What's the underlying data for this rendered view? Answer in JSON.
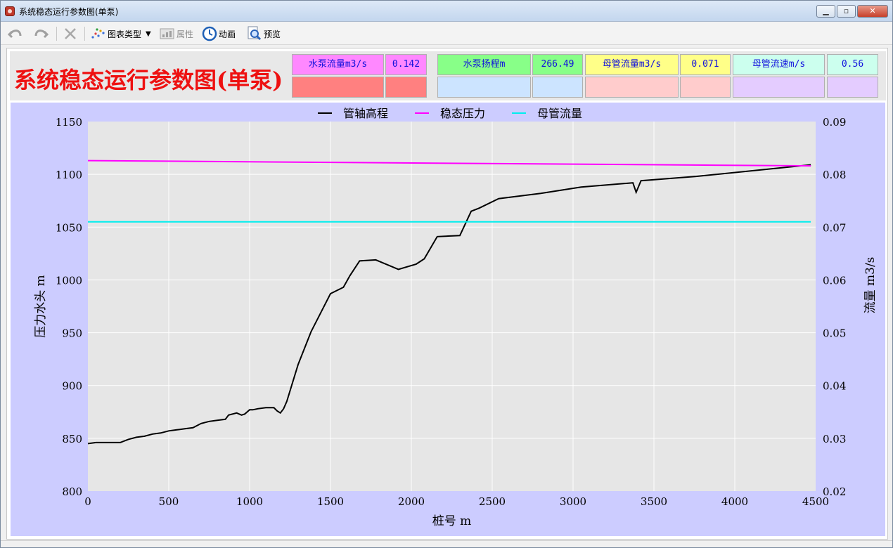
{
  "window": {
    "title": "系统稳态运行参数图(单泵)",
    "min_glyph": "▁",
    "max_glyph": "▫",
    "close_glyph": "✕"
  },
  "toolbar": {
    "undo_icon": "undo-icon",
    "redo_icon": "redo-icon",
    "delete_icon": "delete-icon",
    "chart_type_label": "图表类型",
    "chart_type_arrow": "▼",
    "properties_label": "属性",
    "animation_label": "动画",
    "preview_label": "预览"
  },
  "header": {
    "title": "系统稳态运行参数图(单泵)",
    "params": [
      {
        "label": "水泵流量m3/s",
        "value": "0.142",
        "label_bg": "#ff88ff",
        "value_bg": "#ff88ff",
        "swatch": "#ff8080"
      },
      {
        "label": "水泵扬程m",
        "value": "266.49",
        "label_bg": "#88ff88",
        "value_bg": "#88ff88",
        "swatch": "#cce4ff"
      },
      {
        "label": "母管流量m3/s",
        "value": "0.071",
        "label_bg": "#ffff88",
        "value_bg": "#ffff88",
        "swatch": "#ffcccc"
      },
      {
        "label": "母管流速m/s",
        "value": "0.56",
        "label_bg": "#ccffee",
        "value_bg": "#ccffee",
        "swatch": "#e4ccff"
      }
    ],
    "text_color": "#1010dd"
  },
  "chart_data": {
    "type": "line",
    "title": "",
    "xlabel": "桩号 m",
    "ylabel": "压力水头 m",
    "y2label": "流量 m3/s",
    "xlim": [
      0,
      4500
    ],
    "ylim": [
      800,
      1150
    ],
    "y2lim": [
      0.02,
      0.09
    ],
    "xticks": [
      0,
      500,
      1000,
      1500,
      2000,
      2500,
      3000,
      3500,
      4000,
      4500
    ],
    "yticks": [
      800,
      850,
      900,
      950,
      1000,
      1050,
      1100,
      1150
    ],
    "y2ticks": [
      "0.02",
      "0.03",
      "0.04",
      "0.05",
      "0.06",
      "0.07",
      "0.08",
      "0.09"
    ],
    "grid": true,
    "legend_position": "top-center",
    "series": [
      {
        "name": "管轴高程",
        "color": "#000000",
        "axis": "left",
        "x": [
          0,
          50,
          200,
          250,
          300,
          350,
          400,
          450,
          500,
          550,
          600,
          650,
          700,
          750,
          800,
          850,
          870,
          920,
          950,
          970,
          1000,
          1020,
          1050,
          1100,
          1150,
          1170,
          1190,
          1210,
          1230,
          1260,
          1300,
          1380,
          1500,
          1580,
          1620,
          1680,
          1780,
          1920,
          2030,
          2080,
          2160,
          2300,
          2370,
          2420,
          2540,
          2800,
          3050,
          3370,
          3390,
          3420,
          3760,
          4470
        ],
        "y": [
          845,
          846,
          846,
          849,
          851,
          852,
          854,
          855,
          857,
          858,
          859,
          860,
          864,
          866,
          867,
          868,
          872,
          874,
          872,
          873,
          877,
          877,
          878,
          879,
          879,
          876,
          874,
          878,
          885,
          900,
          920,
          951,
          987,
          993,
          1004,
          1018,
          1019,
          1010,
          1015,
          1020,
          1041,
          1042,
          1065,
          1068,
          1077,
          1082,
          1088,
          1092,
          1083,
          1094,
          1098,
          1109
        ]
      },
      {
        "name": "稳态压力",
        "color": "#ff00ff",
        "axis": "left",
        "x": [
          0,
          4470
        ],
        "y": [
          1113,
          1108
        ]
      },
      {
        "name": "母管流量",
        "color": "#00eeee",
        "axis": "right",
        "x": [
          0,
          4470
        ],
        "y": [
          0.071,
          0.071
        ]
      }
    ]
  }
}
